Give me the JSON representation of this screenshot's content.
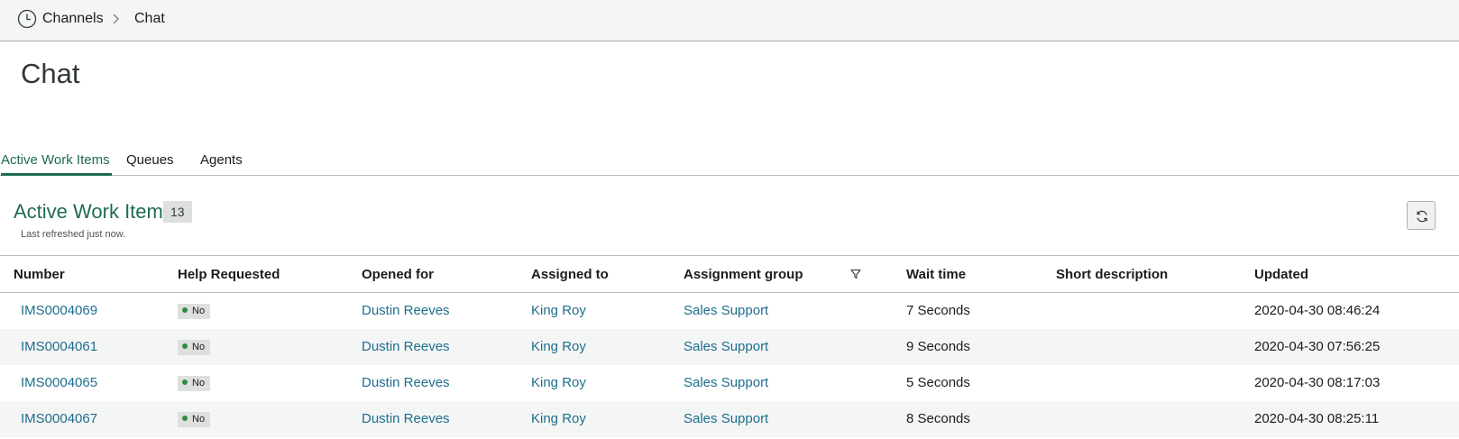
{
  "breadcrumb": {
    "icon": "clock-icon",
    "items": [
      "Channels",
      "Chat"
    ]
  },
  "page": {
    "title": "Chat"
  },
  "tabs": [
    {
      "label": "Active Work Items",
      "active": true
    },
    {
      "label": "Queues",
      "active": false
    },
    {
      "label": "Agents",
      "active": false
    }
  ],
  "list": {
    "title": "Active Work Items",
    "count": "13",
    "refresh_note": "Last refreshed just now.",
    "refresh_icon": "refresh-icon"
  },
  "table": {
    "columns": [
      "Number",
      "Help Requested",
      "Opened for",
      "Assigned to",
      "Assignment group",
      "Wait time",
      "Short description",
      "Updated"
    ],
    "filter_icon": "filter-icon",
    "rows": [
      {
        "number": "IMS0004069",
        "help": "No",
        "opened_for": "Dustin Reeves",
        "assigned_to": "King Roy",
        "group": "Sales Support",
        "wait": "7 Seconds",
        "short_description": "",
        "updated": "2020-04-30 08:46:24"
      },
      {
        "number": "IMS0004061",
        "help": "No",
        "opened_for": "Dustin Reeves",
        "assigned_to": "King Roy",
        "group": "Sales Support",
        "wait": "9 Seconds",
        "short_description": "",
        "updated": "2020-04-30 07:56:25"
      },
      {
        "number": "IMS0004065",
        "help": "No",
        "opened_for": "Dustin Reeves",
        "assigned_to": "King Roy",
        "group": "Sales Support",
        "wait": "5 Seconds",
        "short_description": "",
        "updated": "2020-04-30 08:17:03"
      },
      {
        "number": "IMS0004067",
        "help": "No",
        "opened_for": "Dustin Reeves",
        "assigned_to": "King Roy",
        "group": "Sales Support",
        "wait": "8 Seconds",
        "short_description": "",
        "updated": "2020-04-30 08:25:11"
      }
    ]
  },
  "colors": {
    "brand_green": "#1f6b51",
    "link_blue": "#1d6e8c",
    "status_green": "#2e8b3f"
  }
}
